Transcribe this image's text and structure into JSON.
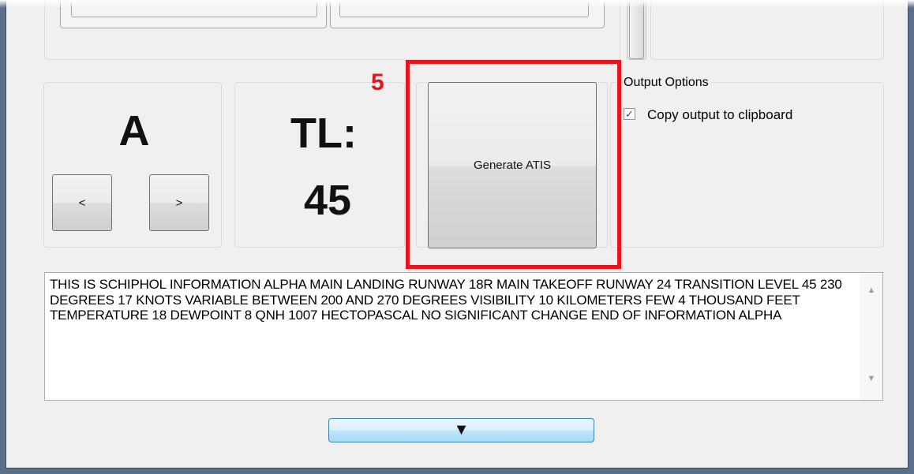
{
  "letter_panel": {
    "letter": "A",
    "prev_label": "<",
    "next_label": ">"
  },
  "transition_panel": {
    "label": "TL:",
    "value": "45"
  },
  "generate_button": {
    "label": "Generate ATIS"
  },
  "annotation": {
    "number": "5",
    "color": "#e8141e"
  },
  "output_options": {
    "title": "Output Options",
    "copy_checkbox": {
      "label": "Copy output to clipboard",
      "checked": true,
      "check_glyph": "✓"
    }
  },
  "output_text": "THIS IS SCHIPHOL INFORMATION ALPHA MAIN LANDING RUNWAY 18R MAIN TAKEOFF RUNWAY 24 TRANSITION LEVEL 45 230 DEGREES 17 KNOTS VARIABLE BETWEEN 200 AND 270 DEGREES VISIBILITY 10 KILOMETERS FEW 4 THOUSAND FEET TEMPERATURE 18 DEWPOINT 8 QNH 1007 HECTOPASCAL NO SIGNIFICANT CHANGE END OF INFORMATION ALPHA",
  "scroll_arrows": {
    "up": "▲",
    "down": "▼"
  },
  "expand_button": {
    "glyph": "▼"
  },
  "colors": {
    "window_border": "#5a6f89",
    "window_background": "#f0f0f0",
    "expand_button": "#bee6fd"
  }
}
